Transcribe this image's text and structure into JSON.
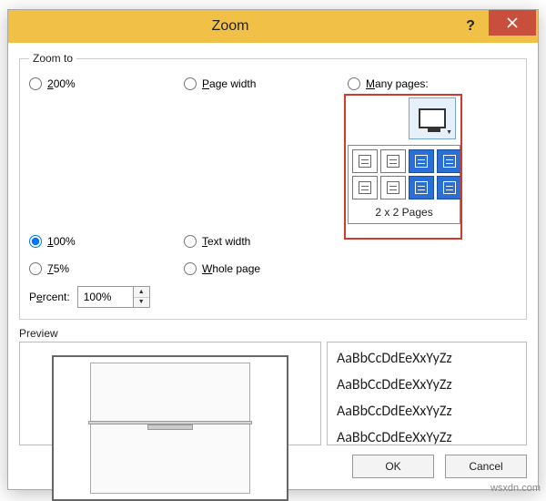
{
  "dialog": {
    "title": "Zoom",
    "group_label": "Zoom to",
    "radios": {
      "r200": "200%",
      "r100": "100%",
      "r75": "75%",
      "page_width": "Page width",
      "text_width": "Text width",
      "whole_page": "Whole page",
      "many_pages": "Many pages:"
    },
    "percent_label": "Percent:",
    "percent_value": "100%",
    "grid_label": "2 x 2 Pages",
    "preview_label": "Preview",
    "sample_text": "AaBbCcDdEeXxYyZz",
    "ok": "OK",
    "cancel": "Cancel"
  },
  "watermark": "wsxdn.com"
}
